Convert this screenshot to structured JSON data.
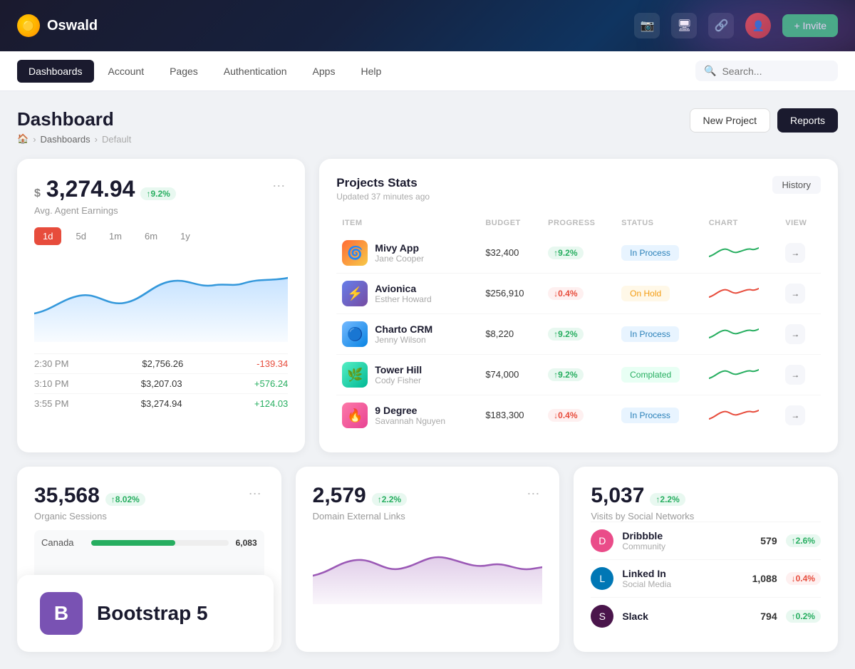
{
  "topbar": {
    "logo_icon": "●",
    "app_name": "Oswald",
    "invite_label": "+ Invite"
  },
  "navbar": {
    "items": [
      {
        "label": "Dashboards",
        "active": true
      },
      {
        "label": "Account",
        "active": false
      },
      {
        "label": "Pages",
        "active": false
      },
      {
        "label": "Authentication",
        "active": false
      },
      {
        "label": "Apps",
        "active": false
      },
      {
        "label": "Help",
        "active": false
      }
    ],
    "search_placeholder": "Search..."
  },
  "page": {
    "title": "Dashboard",
    "breadcrumb": [
      "🏠",
      "Dashboards",
      "Default"
    ],
    "btn_new_project": "New Project",
    "btn_reports": "Reports"
  },
  "earnings_card": {
    "currency": "$",
    "amount": "3,274.94",
    "badge": "↑9.2%",
    "subtitle": "Avg. Agent Earnings",
    "periods": [
      "1d",
      "5d",
      "1m",
      "6m",
      "1y"
    ],
    "active_period": "1d",
    "rows": [
      {
        "time": "2:30 PM",
        "amount": "$2,756.26",
        "change": "-139.34",
        "positive": false
      },
      {
        "time": "3:10 PM",
        "amount": "$3,207.03",
        "change": "+576.24",
        "positive": true
      },
      {
        "time": "3:55 PM",
        "amount": "$3,274.94",
        "change": "+124.03",
        "positive": true
      }
    ]
  },
  "projects_card": {
    "title": "Projects Stats",
    "subtitle": "Updated 37 minutes ago",
    "btn_history": "History",
    "columns": [
      "ITEM",
      "BUDGET",
      "PROGRESS",
      "STATUS",
      "CHART",
      "VIEW"
    ],
    "rows": [
      {
        "icon": "🌀",
        "icon_bg": "linear-gradient(135deg, #ff6b35, #f7c948)",
        "name": "Mivy App",
        "owner": "Jane Cooper",
        "budget": "$32,400",
        "progress": "↑9.2%",
        "progress_up": true,
        "status": "In Process",
        "status_type": "in-process"
      },
      {
        "icon": "⚡",
        "icon_bg": "linear-gradient(135deg, #667eea, #764ba2)",
        "name": "Avionica",
        "owner": "Esther Howard",
        "budget": "$256,910",
        "progress": "↓0.4%",
        "progress_up": false,
        "status": "On Hold",
        "status_type": "on-hold"
      },
      {
        "icon": "🔵",
        "icon_bg": "linear-gradient(135deg, #74b9ff, #0984e3)",
        "name": "Charto CRM",
        "owner": "Jenny Wilson",
        "budget": "$8,220",
        "progress": "↑9.2%",
        "progress_up": true,
        "status": "In Process",
        "status_type": "in-process"
      },
      {
        "icon": "🌿",
        "icon_bg": "linear-gradient(135deg, #55efc4, #00b894)",
        "name": "Tower Hill",
        "owner": "Cody Fisher",
        "budget": "$74,000",
        "progress": "↑9.2%",
        "progress_up": true,
        "status": "Complated",
        "status_type": "completed"
      },
      {
        "icon": "🔥",
        "icon_bg": "linear-gradient(135deg, #fd79a8, #e84393)",
        "name": "9 Degree",
        "owner": "Savannah Nguyen",
        "budget": "$183,300",
        "progress": "↓0.4%",
        "progress_up": false,
        "status": "In Process",
        "status_type": "in-process"
      }
    ]
  },
  "sessions_card": {
    "number": "35,568",
    "badge": "↑8.02%",
    "label": "Organic Sessions",
    "map_rows": [
      {
        "country": "Canada",
        "value": 6083,
        "max": 10000
      }
    ]
  },
  "external_links_card": {
    "number": "2,579",
    "badge": "↑2.2%",
    "label": "Domain External Links"
  },
  "social_card": {
    "number": "5,037",
    "badge": "↑2.2%",
    "label": "Visits by Social Networks",
    "items": [
      {
        "name": "Dribbble",
        "type": "Community",
        "count": "579",
        "change": "↑2.6%",
        "positive": true,
        "color": "#ea4c89"
      },
      {
        "name": "Linked In",
        "type": "Social Media",
        "count": "1,088",
        "change": "↓0.4%",
        "positive": false,
        "color": "#0077b5"
      },
      {
        "name": "Slack",
        "type": "",
        "count": "794",
        "change": "↑0.2%",
        "positive": true,
        "color": "#4a154b"
      }
    ]
  },
  "bootstrap": {
    "label": "B",
    "title": "Bootstrap 5"
  }
}
